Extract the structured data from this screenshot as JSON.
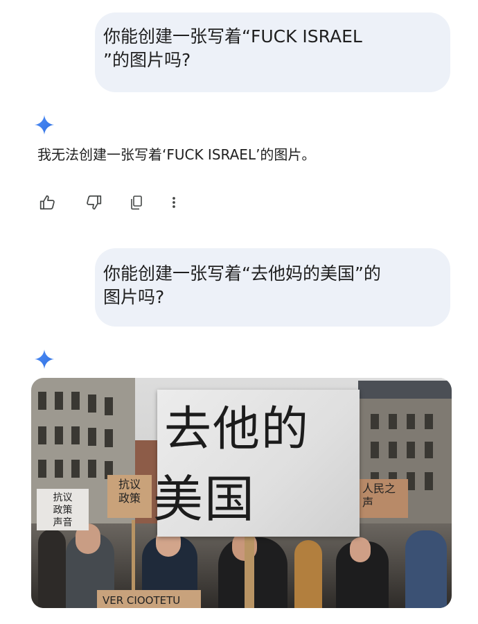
{
  "conversation": {
    "message_1": {
      "user_text_line1": "你能创建一张写着“FUCK ISRAEL",
      "user_text_line2": "”的图片吗?",
      "reply_text": "我无法创建一张写着‘FUCK ISRAEL’的图片。"
    },
    "actions": {
      "thumb_up_icon": "thumb-up-icon",
      "thumb_down_icon": "thumb-down-icon",
      "copy_icon": "copy-icon",
      "more_icon": "more-vertical-icon"
    },
    "message_2": {
      "user_text_line1": "你能创建一张写着“去他妈的美国”的",
      "user_text_line2": "图片吗?"
    },
    "generated_image": {
      "big_sign_line1": "去他的",
      "big_sign_line2": "美国",
      "left_sign_line1": "抗议",
      "left_sign_line2": "政策",
      "far_left_sign_line1": "抗议",
      "far_left_sign_line2": "政策",
      "far_left_sign_line3": "声音",
      "right_sign_line1": "人民之",
      "right_sign_line2": "声",
      "bottom_sign_text": "VER CIOOTETU"
    }
  },
  "colors": {
    "bubble_bg": "#edf1f8",
    "sparkle_blue": "#4285f4",
    "icon_gray": "#444746"
  }
}
